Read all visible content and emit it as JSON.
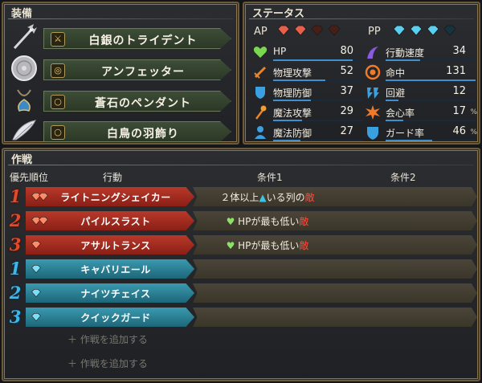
{
  "equipment": {
    "title": "装備",
    "items": [
      {
        "name": "白銀のトライデント",
        "slot_icon": "weapon-slot-icon"
      },
      {
        "name": "アンフェッター",
        "slot_icon": "shield-slot-icon"
      },
      {
        "name": "蒼石のペンダント",
        "slot_icon": "accessory-slot-icon"
      },
      {
        "name": "白鳥の羽飾り",
        "slot_icon": "accessory-slot-icon"
      }
    ]
  },
  "status": {
    "title": "ステータス",
    "ap_label": "AP",
    "pp_label": "PP",
    "ap_filled": 2,
    "ap_total": 4,
    "pp_filled": 3,
    "pp_total": 4,
    "left": [
      {
        "label": "HP",
        "value": "80",
        "unit": ""
      },
      {
        "label": "物理攻撃",
        "value": "52",
        "unit": ""
      },
      {
        "label": "物理防御",
        "value": "37",
        "unit": ""
      },
      {
        "label": "魔法攻撃",
        "value": "29",
        "unit": ""
      },
      {
        "label": "魔法防御",
        "value": "27",
        "unit": ""
      }
    ],
    "right": [
      {
        "label": "行動速度",
        "value": "34",
        "unit": ""
      },
      {
        "label": "命中",
        "value": "131",
        "unit": ""
      },
      {
        "label": "回避",
        "value": "12",
        "unit": ""
      },
      {
        "label": "会心率",
        "value": "17",
        "unit": "%"
      },
      {
        "label": "ガード率",
        "value": "46",
        "unit": "%"
      }
    ]
  },
  "tactics": {
    "title": "作戦",
    "headers": {
      "priority": "優先順位",
      "action": "行動",
      "cond1": "条件1",
      "cond2": "条件2"
    },
    "rows": [
      {
        "priority": "1",
        "type": "red",
        "gem_count": 2,
        "action": "ライトニングシェイカー",
        "cond1_pre": "２体以上",
        "cond1_tri": "▲",
        "cond1_mid": "いる列の",
        "cond1_hl": "敵",
        "cond1_heart": ""
      },
      {
        "priority": "2",
        "type": "red",
        "gem_count": 2,
        "action": "パイルスラスト",
        "cond1_pre": "",
        "cond1_tri": "",
        "cond1_mid": "HPが最も低い",
        "cond1_hl": "敵",
        "cond1_heart": "♥"
      },
      {
        "priority": "3",
        "type": "red",
        "gem_count": 1,
        "action": "アサルトランス",
        "cond1_pre": "",
        "cond1_tri": "",
        "cond1_mid": "HPが最も低い",
        "cond1_hl": "敵",
        "cond1_heart": "♥"
      },
      {
        "priority": "1",
        "type": "blue",
        "gem_count": 1,
        "action": "キャバリエール",
        "cond1_pre": "",
        "cond1_tri": "",
        "cond1_mid": "",
        "cond1_hl": "",
        "cond1_heart": ""
      },
      {
        "priority": "2",
        "type": "blue",
        "gem_count": 1,
        "action": "ナイツチェイス",
        "cond1_pre": "",
        "cond1_tri": "",
        "cond1_mid": "",
        "cond1_hl": "",
        "cond1_heart": ""
      },
      {
        "priority": "3",
        "type": "blue",
        "gem_count": 1,
        "action": "クイックガード",
        "cond1_pre": "",
        "cond1_tri": "",
        "cond1_mid": "",
        "cond1_hl": "",
        "cond1_heart": ""
      }
    ],
    "add_label": "＋ 作戦を追加する"
  },
  "colors": {
    "red_action": "#a02c20",
    "blue_action": "#2a8096",
    "ap_gem": "#e8604a",
    "pp_gem": "#5ad0f0",
    "frame_gold": "#8a7650"
  }
}
